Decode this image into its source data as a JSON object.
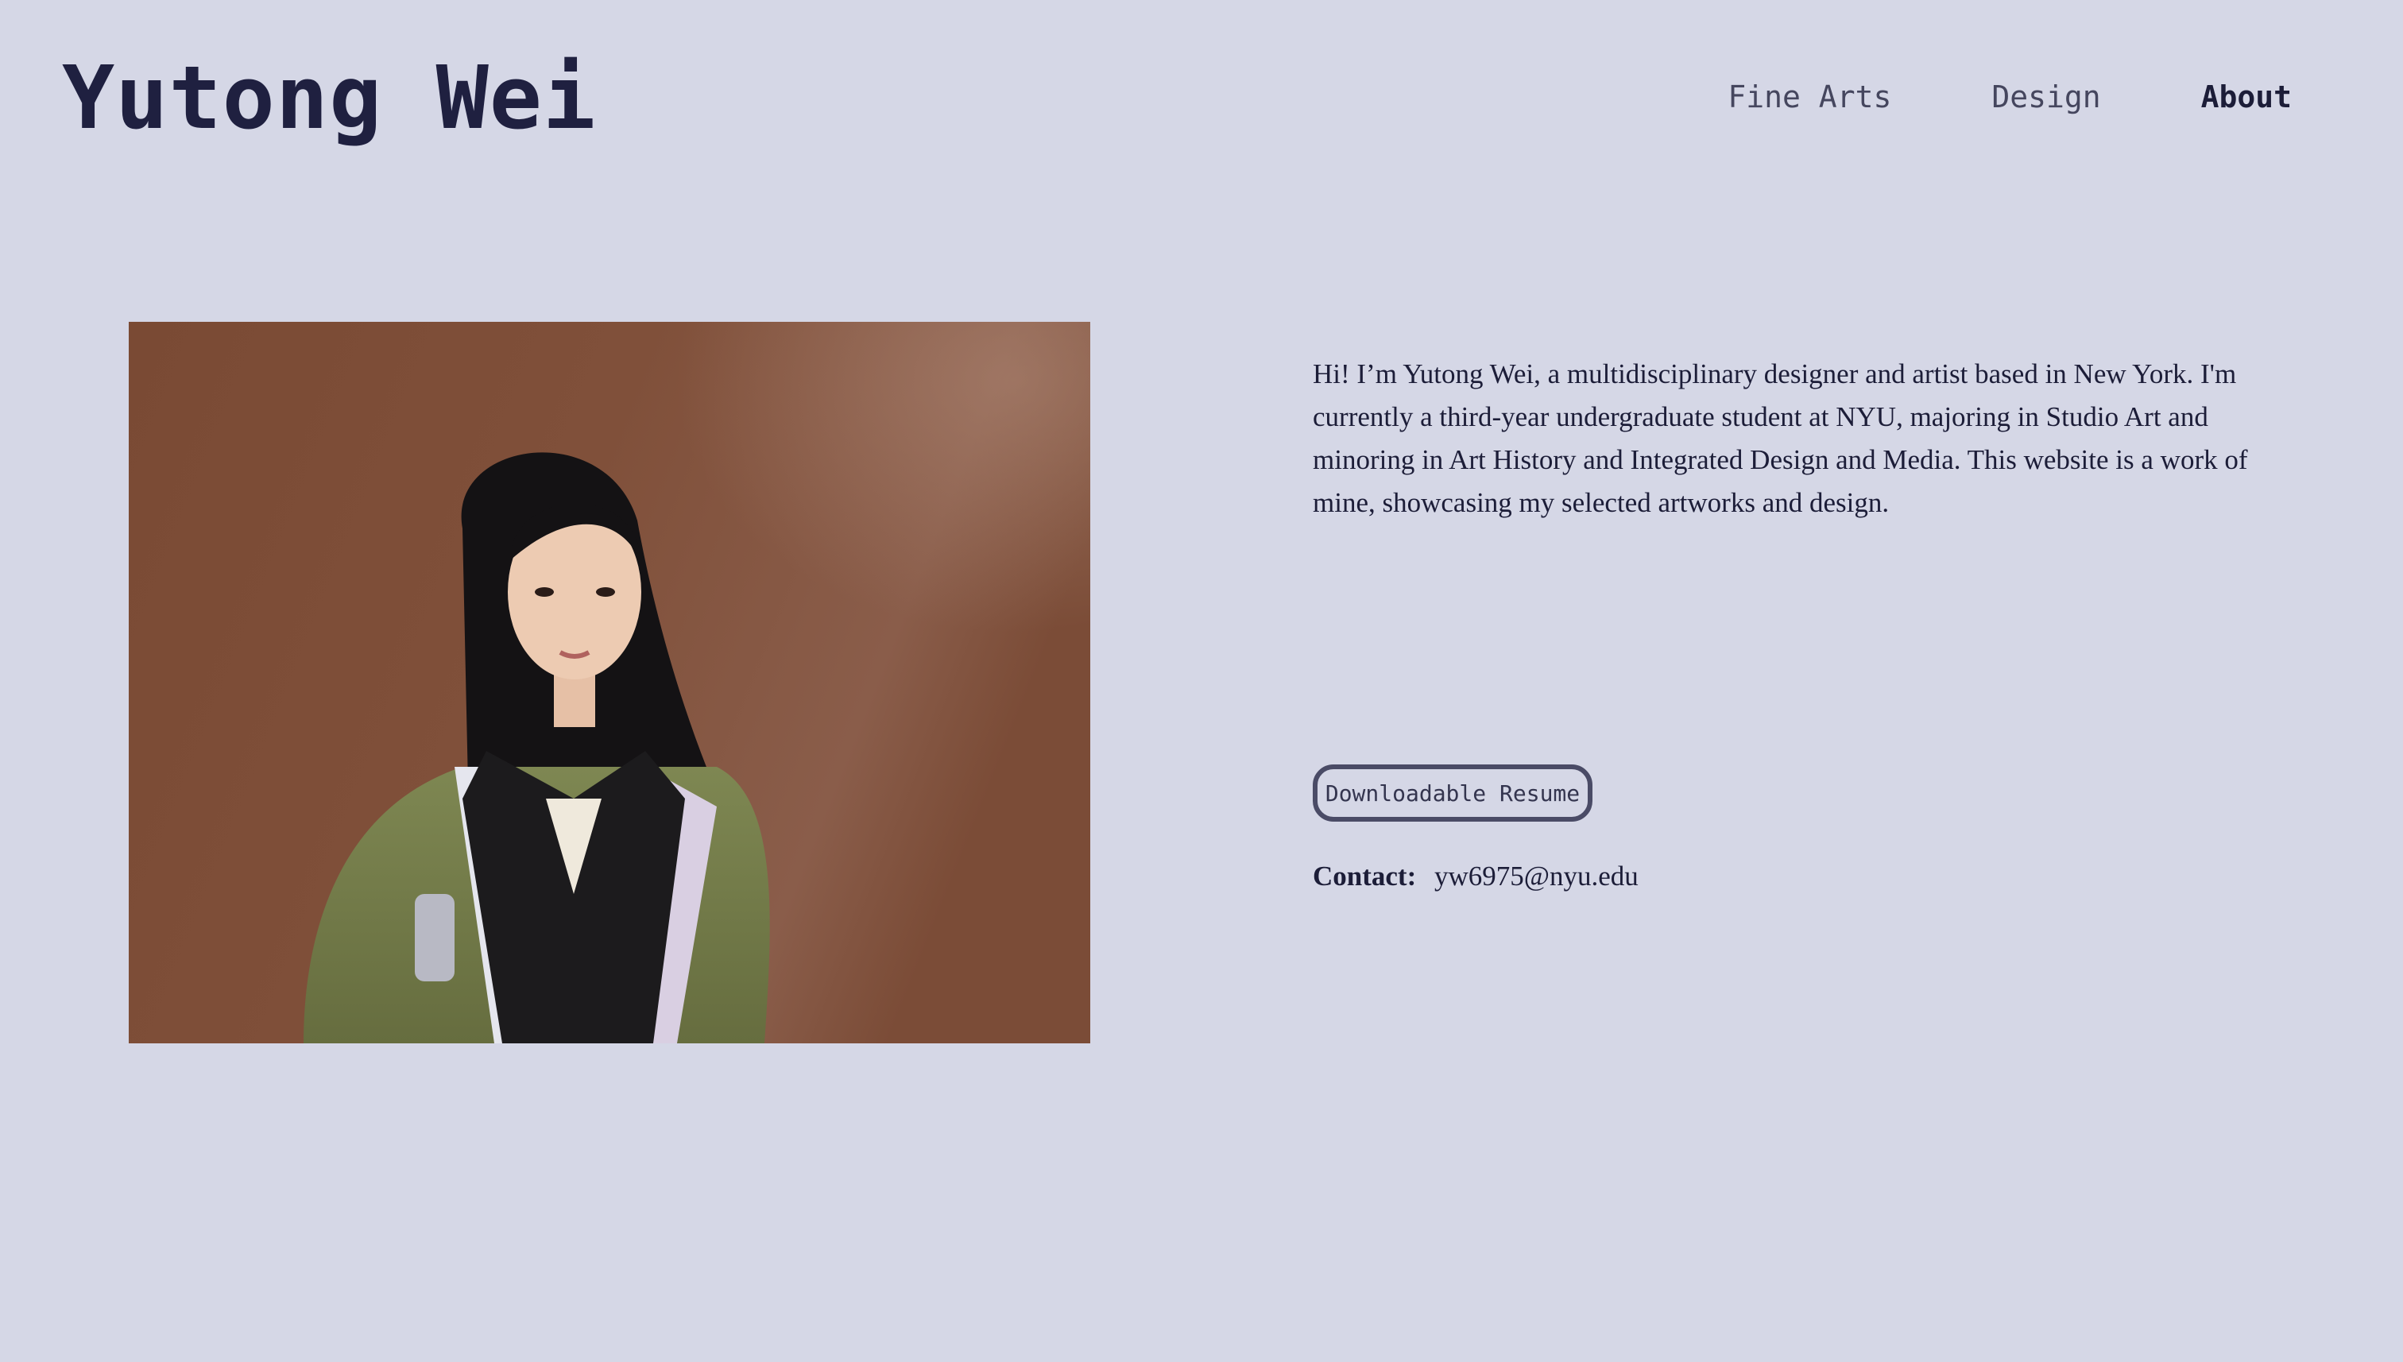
{
  "header": {
    "site_title": "Yutong Wei"
  },
  "nav": {
    "items": [
      {
        "label": "Fine Arts",
        "active": false
      },
      {
        "label": "Design",
        "active": false
      },
      {
        "label": "About",
        "active": true
      }
    ]
  },
  "about": {
    "bio": "Hi! I’m Yutong Wei, a multidisciplinary designer and artist based in New York. I'm currently a third-year undergraduate student at NYU, majoring in Studio Art and minoring in Art History and Integrated Design and Media. This website is a work of mine, showcasing my selected artworks and design.",
    "resume_button_label": "Downloadable Resume",
    "contact_label": "Contact:",
    "contact_email": "yw6975@nyu.edu"
  },
  "colors": {
    "background": "#d5d7e6",
    "text": "#1c1d38",
    "button_border": "#4a4b66"
  }
}
